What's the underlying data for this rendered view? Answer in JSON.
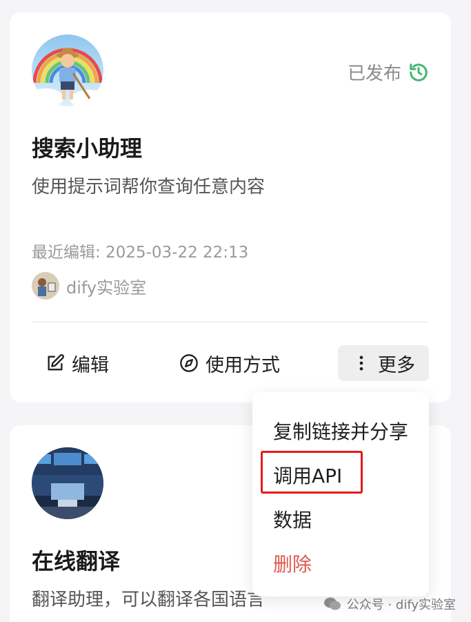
{
  "cards": [
    {
      "name": "搜索小助理",
      "description": "使用提示词帮你查询任意内容",
      "status": "已发布",
      "edited": "最近编辑: 2025-03-22 22:13",
      "author": "dify实验室",
      "actions": {
        "edit": "编辑",
        "usage": "使用方式",
        "more": "更多"
      }
    },
    {
      "name": "在线翻译",
      "description": "翻译助理，可以翻译各国语言"
    }
  ],
  "more_menu": {
    "items": [
      "复制链接并分享",
      "调用API",
      "数据",
      "删除"
    ],
    "highlighted_index": 1
  },
  "watermark": "公众号 · dify实验室",
  "colors": {
    "status_icon": "#3fb86b",
    "danger": "#e0594f",
    "highlight_border": "#e61a1a"
  },
  "icons": {
    "status": "history-icon",
    "edit": "edit-icon",
    "usage": "compass-icon",
    "more": "more-vertical-icon"
  }
}
